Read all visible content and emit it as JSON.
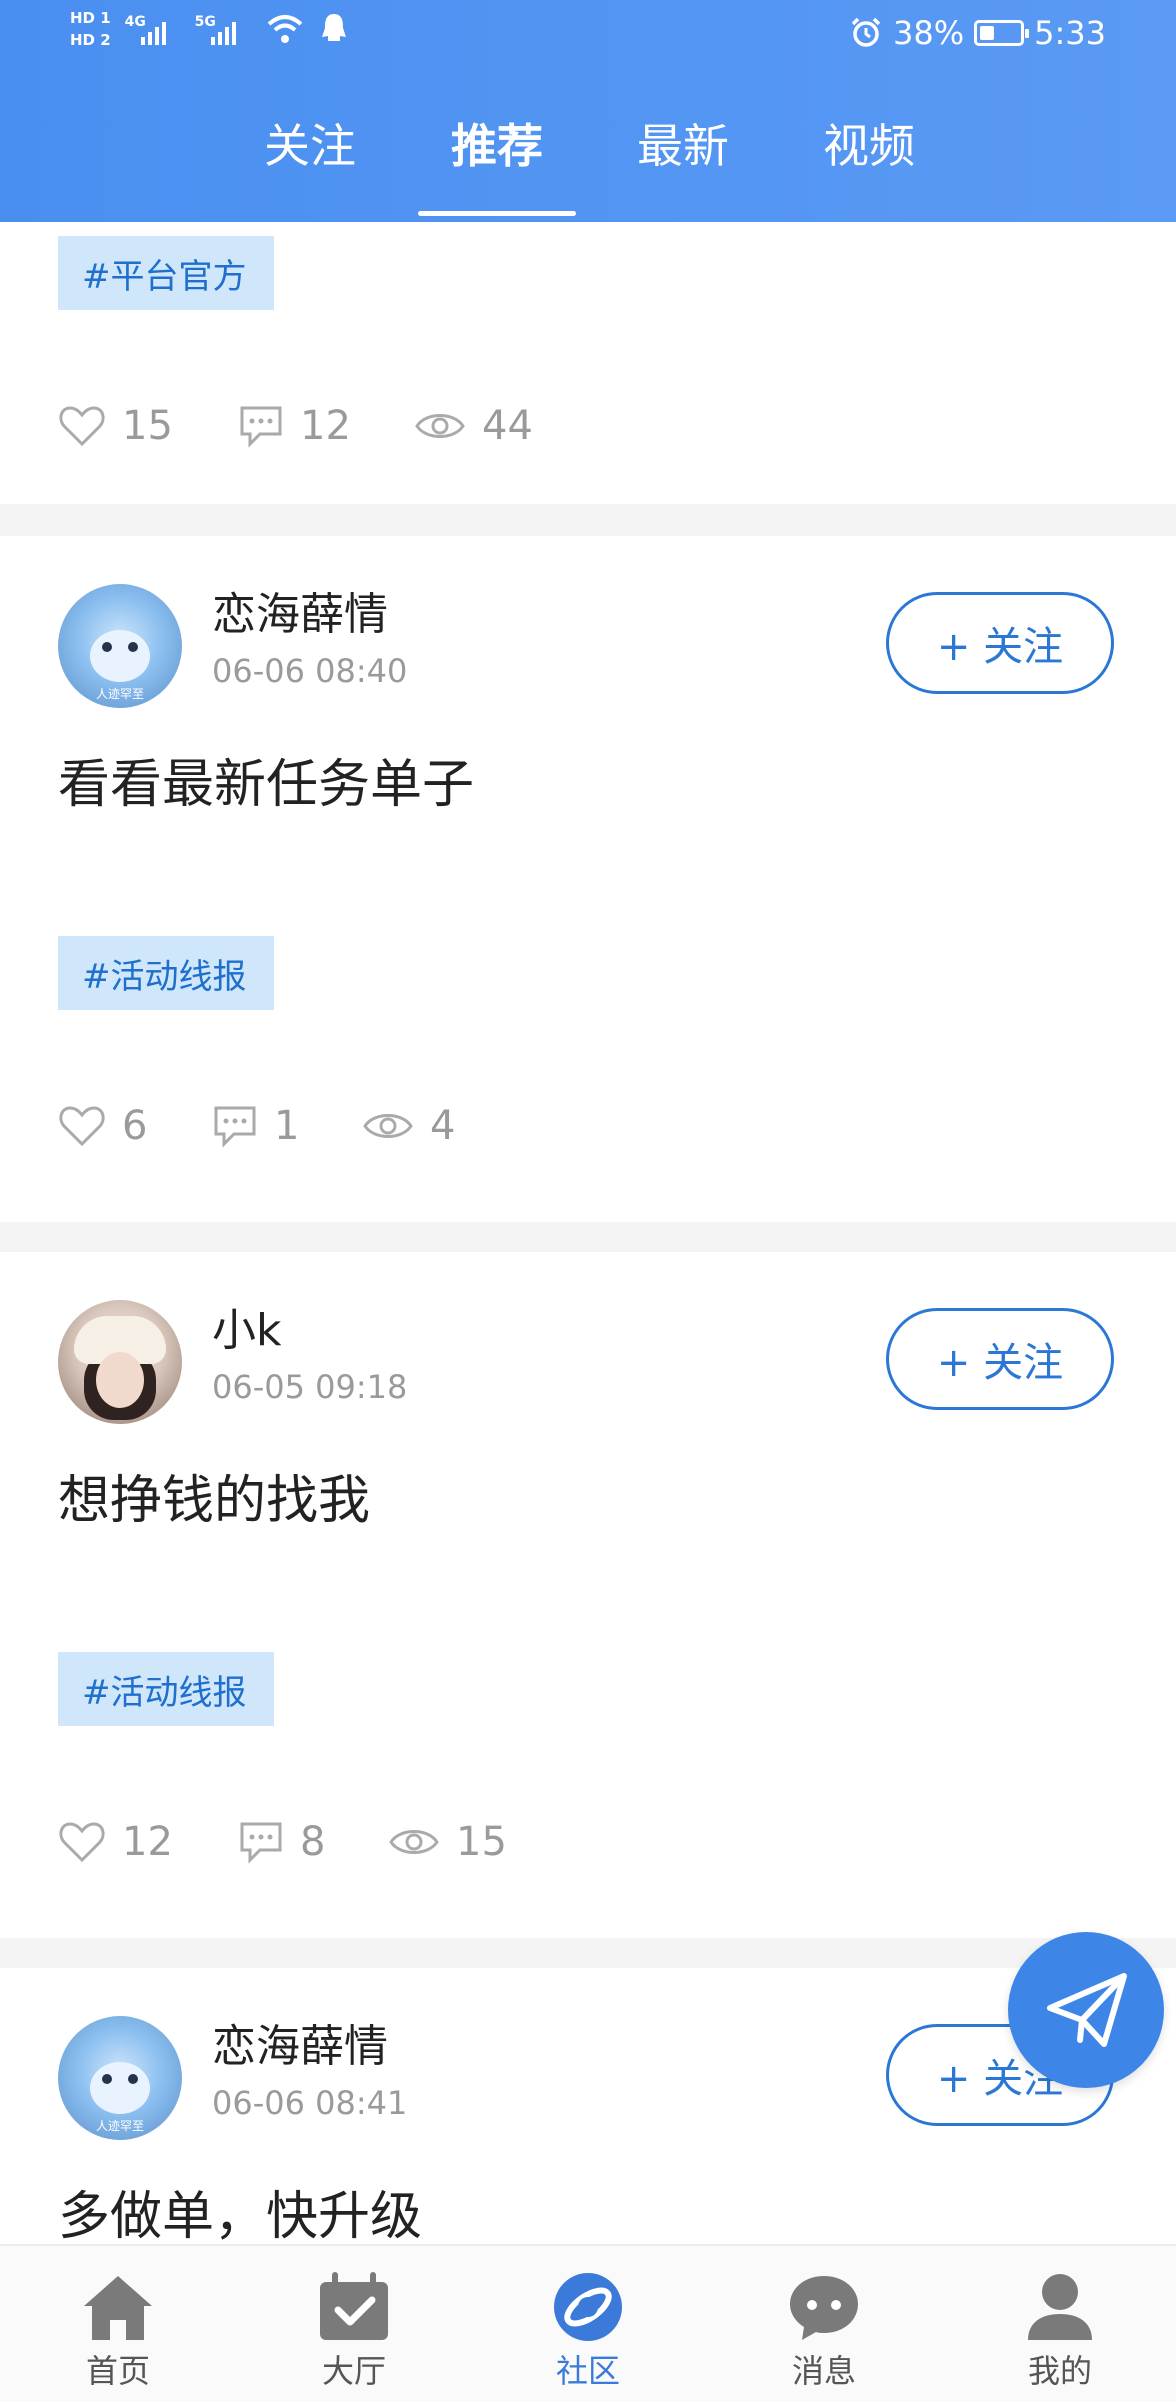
{
  "status_bar": {
    "hd1": "HD 1",
    "hd2": "HD 2",
    "net1": "4G",
    "net2": "5G",
    "battery": "38%",
    "battery_level": 0.38,
    "time": "5:33"
  },
  "tabs": [
    {
      "label": "关注",
      "active": false
    },
    {
      "label": "推荐",
      "active": true
    },
    {
      "label": "最新",
      "active": false
    },
    {
      "label": "视频",
      "active": false
    }
  ],
  "posts": [
    {
      "tag": "#平台官方",
      "likes": "15",
      "comments": "12",
      "views": "44"
    },
    {
      "username": "恋海薛情",
      "time": "06-06 08:40",
      "follow_label": "+ 关注",
      "text": "看看最新任务单子",
      "tag": "#活动线报",
      "likes": "6",
      "comments": "1",
      "views": "4"
    },
    {
      "username": "小k",
      "time": "06-05 09:18",
      "follow_label": "+ 关注",
      "text": "想挣钱的找我",
      "tag": "#活动线报",
      "likes": "12",
      "comments": "8",
      "views": "15"
    },
    {
      "username": "恋海薛情",
      "time": "06-06 08:41",
      "follow_label": "+ 关注",
      "text": "多做单，快升级"
    }
  ],
  "avatar_caption": "人迹罕至",
  "bottom_nav": [
    {
      "label": "首页",
      "icon": "home-icon",
      "active": false
    },
    {
      "label": "大厅",
      "icon": "calendar-check-icon",
      "active": false
    },
    {
      "label": "社区",
      "icon": "planet-icon",
      "active": true
    },
    {
      "label": "消息",
      "icon": "chat-bubble-icon",
      "active": false
    },
    {
      "label": "我的",
      "icon": "person-icon",
      "active": false
    }
  ],
  "colors": {
    "header": "#4a8ff0",
    "accent": "#2a77d6",
    "tag_bg": "#cfe6fb",
    "tag_text": "#1f6fcc"
  }
}
